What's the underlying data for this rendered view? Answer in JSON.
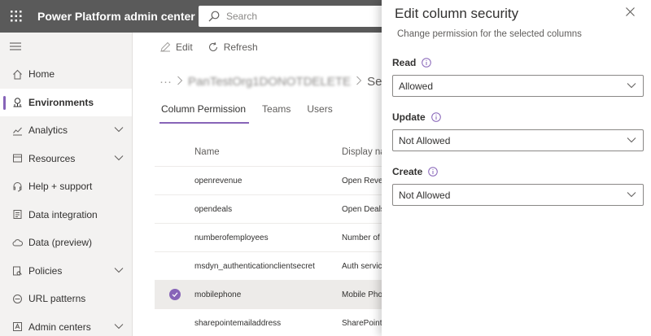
{
  "app": {
    "title": "Power Platform admin center"
  },
  "search": {
    "placeholder": "Search"
  },
  "sidebar": {
    "items": [
      {
        "label": "Home",
        "icon": "home-icon",
        "active": false,
        "expandable": false
      },
      {
        "label": "Environments",
        "icon": "environments-icon",
        "active": true,
        "expandable": false
      },
      {
        "label": "Analytics",
        "icon": "analytics-icon",
        "active": false,
        "expandable": true
      },
      {
        "label": "Resources",
        "icon": "resources-icon",
        "active": false,
        "expandable": true
      },
      {
        "label": "Help + support",
        "icon": "headset-icon",
        "active": false,
        "expandable": false
      },
      {
        "label": "Data integration",
        "icon": "data-integration-icon",
        "active": false,
        "expandable": false
      },
      {
        "label": "Data (preview)",
        "icon": "cloud-icon",
        "active": false,
        "expandable": false
      },
      {
        "label": "Policies",
        "icon": "policies-icon",
        "active": false,
        "expandable": true
      },
      {
        "label": "URL patterns",
        "icon": "link-icon",
        "active": false,
        "expandable": false
      },
      {
        "label": "Admin centers",
        "icon": "admin-centers-icon",
        "active": false,
        "expandable": true
      }
    ]
  },
  "toolbar": {
    "edit_label": "Edit",
    "refresh_label": "Refresh"
  },
  "breadcrumb": {
    "ellipsis": "···",
    "org": "PanTestOrg1DONOTDELETE",
    "current": "Settin"
  },
  "tabs": [
    {
      "label": "Column Permission",
      "active": true
    },
    {
      "label": "Teams",
      "active": false
    },
    {
      "label": "Users",
      "active": false
    }
  ],
  "grid": {
    "headers": {
      "name": "Name",
      "display": "Display na"
    },
    "rows": [
      {
        "name": "openrevenue",
        "display": "Open Rever",
        "selected": false
      },
      {
        "name": "opendeals",
        "display": "Open Deals",
        "selected": false
      },
      {
        "name": "numberofemployees",
        "display": "Number of",
        "selected": false
      },
      {
        "name": "msdyn_authenticationclientsecret",
        "display": "Auth servic",
        "selected": false
      },
      {
        "name": "mobilephone",
        "display": "Mobile Pho",
        "selected": true
      },
      {
        "name": "sharepointemailaddress",
        "display": "SharePoint",
        "selected": false
      }
    ]
  },
  "panel": {
    "title": "Edit column security",
    "subtitle": "Change permission for the selected columns",
    "fields": [
      {
        "label": "Read",
        "value": "Allowed"
      },
      {
        "label": "Update",
        "value": "Not Allowed"
      },
      {
        "label": "Create",
        "value": "Not Allowed"
      }
    ]
  },
  "colors": {
    "accent": "#8764b8",
    "topbar": "#5a5a5a",
    "sidebar": "#f3f2f1"
  }
}
